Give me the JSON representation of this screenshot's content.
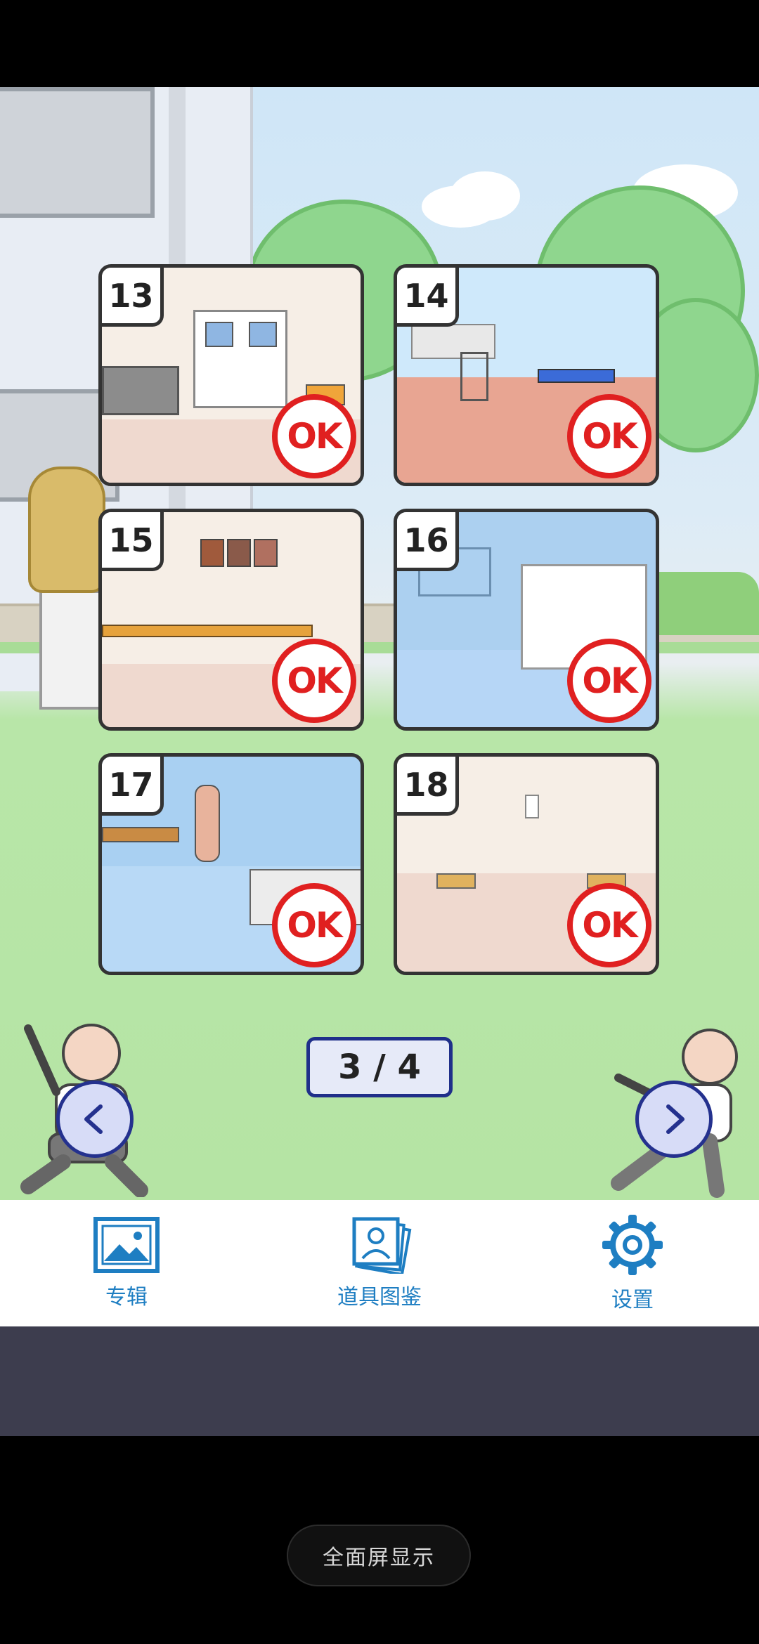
{
  "levels": [
    {
      "number": "13",
      "status": "OK"
    },
    {
      "number": "14",
      "status": "OK"
    },
    {
      "number": "15",
      "status": "OK"
    },
    {
      "number": "16",
      "status": "OK"
    },
    {
      "number": "17",
      "status": "OK"
    },
    {
      "number": "18",
      "status": "OK"
    }
  ],
  "pager": {
    "text": "3 / 4",
    "current_page": 3,
    "total_pages": 4
  },
  "tabs": [
    {
      "label": "专辑",
      "icon": "album-icon"
    },
    {
      "label": "道具图鉴",
      "icon": "item-catalog-icon"
    },
    {
      "label": "设置",
      "icon": "gear-icon"
    }
  ],
  "fullscreen_label": "全面屏显示",
  "colors": {
    "accent_blue": "#1e7ec2",
    "ok_red": "#e02020",
    "nav_blue": "#24318e"
  }
}
